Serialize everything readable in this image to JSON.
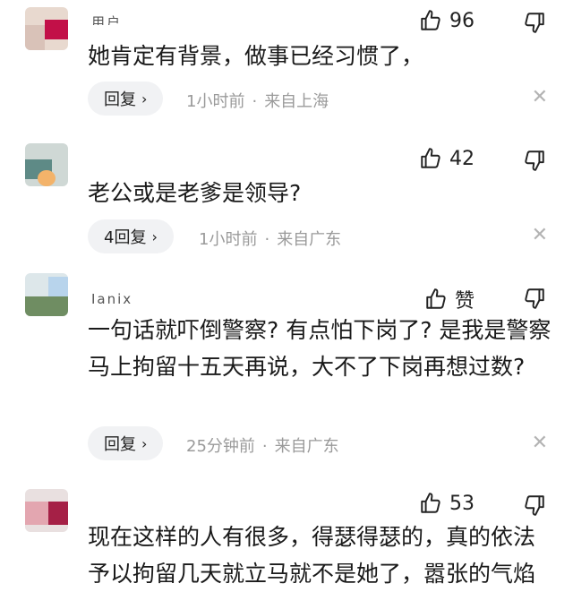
{
  "comments": [
    {
      "username": "用户",
      "likes": "96",
      "text": "她肯定有背景，做事已经习惯了，",
      "reply_label": "回复",
      "time": "1小时前",
      "location": "来自上海"
    },
    {
      "username": "",
      "likes": "42",
      "text": "老公或是老爹是领导?",
      "reply_label": "4回复",
      "time": "1小时前",
      "location": "来自广东"
    },
    {
      "username": "Janix",
      "likes": "赞",
      "text": "一句话就吓倒警察? 有点怕下岗了? 是我是警察马上拘留十五天再说，大不了下岗再想过数?",
      "reply_label": "回复",
      "time": "25分钟前",
      "location": "来自广东"
    },
    {
      "username": "",
      "likes": "53",
      "text": "现在这样的人有很多，得瑟得瑟的，真的依法予以拘留几天就立马就不是她了，嚣张的气焰",
      "reply_label": "",
      "time": "",
      "location": ""
    }
  ],
  "icons": {
    "like": "thumbs-up-icon",
    "dislike": "thumbs-down-icon",
    "close": "close-icon",
    "chevron": "chevron-right-icon"
  },
  "colors": {
    "meta": "#9a9a9a",
    "reply_bg": "#f1f2f4"
  }
}
